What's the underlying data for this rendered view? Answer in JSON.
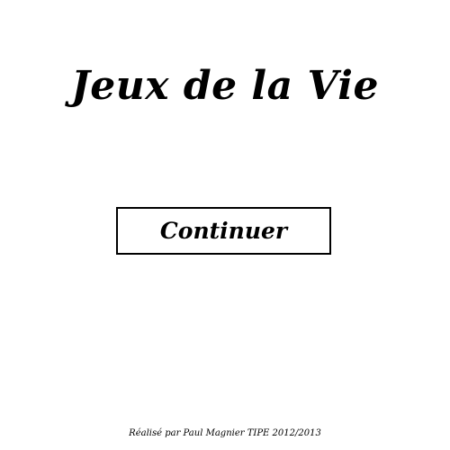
{
  "title": "Jeux de la Vie",
  "menu": {
    "continue_label": "Continuer"
  },
  "footer": {
    "credit": "Réalisé par Paul Magnier TIPE 2012/2013"
  },
  "colors": {
    "background": "#ffffff",
    "text": "#000000",
    "button_border": "#000000"
  }
}
